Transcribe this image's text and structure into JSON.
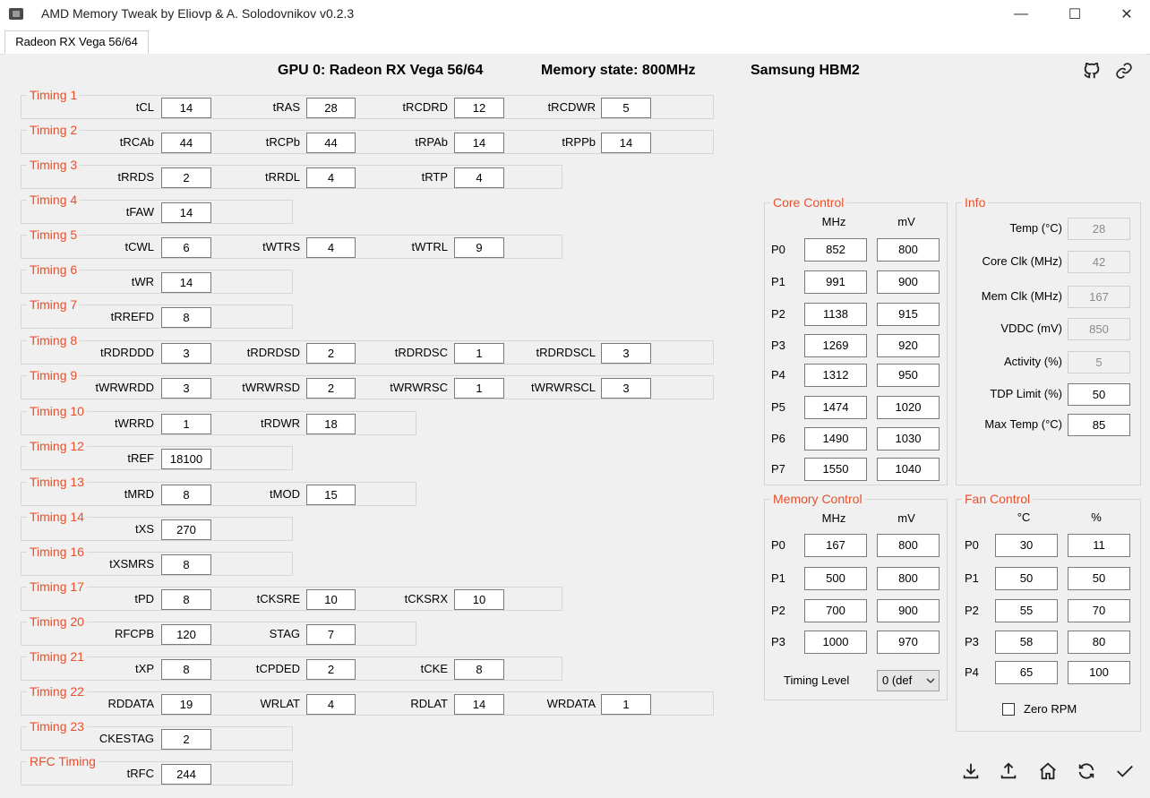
{
  "window": {
    "title": "AMD Memory Tweak by Eliovp & A. Solodovnikov v0.2.3"
  },
  "tabs": [
    "Radeon RX Vega 56/64"
  ],
  "header": {
    "gpu": "GPU 0: Radeon RX Vega 56/64",
    "memory_state": "Memory state: 800MHz",
    "memory_type": "Samsung HBM2"
  },
  "icons": {
    "github": "github-icon",
    "link": "link-icon",
    "download": "download-icon",
    "upload": "upload-icon",
    "home": "home-icon",
    "refresh": "refresh-icon",
    "apply": "check-icon"
  },
  "timings": [
    {
      "title": "Timing 1",
      "fields": [
        {
          "label": "tCL",
          "value": "14"
        },
        {
          "label": "tRAS",
          "value": "28"
        },
        {
          "label": "tRCDRD",
          "value": "12"
        },
        {
          "label": "tRCDWR",
          "value": "5"
        }
      ]
    },
    {
      "title": "Timing 2",
      "fields": [
        {
          "label": "tRCAb",
          "value": "44"
        },
        {
          "label": "tRCPb",
          "value": "44"
        },
        {
          "label": "tRPAb",
          "value": "14"
        },
        {
          "label": "tRPPb",
          "value": "14"
        }
      ]
    },
    {
      "title": "Timing 3",
      "fields": [
        {
          "label": "tRRDS",
          "value": "2"
        },
        {
          "label": "tRRDL",
          "value": "4"
        },
        {
          "label": "tRTP",
          "value": "4"
        }
      ]
    },
    {
      "title": "Timing 4",
      "fields": [
        {
          "label": "tFAW",
          "value": "14"
        }
      ]
    },
    {
      "title": "Timing 5",
      "fields": [
        {
          "label": "tCWL",
          "value": "6"
        },
        {
          "label": "tWTRS",
          "value": "4"
        },
        {
          "label": "tWTRL",
          "value": "9"
        }
      ]
    },
    {
      "title": "Timing 6",
      "fields": [
        {
          "label": "tWR",
          "value": "14"
        }
      ]
    },
    {
      "title": "Timing 7",
      "fields": [
        {
          "label": "tRREFD",
          "value": "8"
        }
      ]
    },
    {
      "title": "Timing 8",
      "fields": [
        {
          "label": "tRDRDDD",
          "value": "3"
        },
        {
          "label": "tRDRDSD",
          "value": "2"
        },
        {
          "label": "tRDRDSC",
          "value": "1"
        },
        {
          "label": "tRDRDSCL",
          "value": "3"
        }
      ]
    },
    {
      "title": "Timing 9",
      "fields": [
        {
          "label": "tWRWRDD",
          "value": "3"
        },
        {
          "label": "tWRWRSD",
          "value": "2"
        },
        {
          "label": "tWRWRSC",
          "value": "1"
        },
        {
          "label": "tWRWRSCL",
          "value": "3"
        }
      ]
    },
    {
      "title": "Timing 10",
      "fields": [
        {
          "label": "tWRRD",
          "value": "1"
        },
        {
          "label": "tRDWR",
          "value": "18"
        }
      ]
    },
    {
      "title": "Timing 12",
      "fields": [
        {
          "label": "tREF",
          "value": "18100"
        }
      ]
    },
    {
      "title": "Timing 13",
      "fields": [
        {
          "label": "tMRD",
          "value": "8"
        },
        {
          "label": "tMOD",
          "value": "15"
        }
      ]
    },
    {
      "title": "Timing 14",
      "fields": [
        {
          "label": "tXS",
          "value": "270"
        }
      ]
    },
    {
      "title": "Timing 16",
      "fields": [
        {
          "label": "tXSMRS",
          "value": "8"
        }
      ]
    },
    {
      "title": "Timing 17",
      "fields": [
        {
          "label": "tPD",
          "value": "8"
        },
        {
          "label": "tCKSRE",
          "value": "10"
        },
        {
          "label": "tCKSRX",
          "value": "10"
        }
      ]
    },
    {
      "title": "Timing 20",
      "fields": [
        {
          "label": "RFCPB",
          "value": "120"
        },
        {
          "label": "STAG",
          "value": "7"
        }
      ]
    },
    {
      "title": "Timing 21",
      "fields": [
        {
          "label": "tXP",
          "value": "8"
        },
        {
          "label": "tCPDED",
          "value": "2"
        },
        {
          "label": "tCKE",
          "value": "8"
        }
      ]
    },
    {
      "title": "Timing 22",
      "fields": [
        {
          "label": "RDDATA",
          "value": "19"
        },
        {
          "label": "WRLAT",
          "value": "4"
        },
        {
          "label": "RDLAT",
          "value": "14"
        },
        {
          "label": "WRDATA",
          "value": "1"
        }
      ]
    },
    {
      "title": "Timing 23",
      "fields": [
        {
          "label": "CKESTAG",
          "value": "2"
        }
      ]
    },
    {
      "title": "RFC Timing",
      "fields": [
        {
          "label": "tRFC",
          "value": "244"
        }
      ]
    }
  ],
  "core_control": {
    "title": "Core Control",
    "col1": "MHz",
    "col2": "mV",
    "rows": [
      [
        "P0",
        "852",
        "800"
      ],
      [
        "P1",
        "991",
        "900"
      ],
      [
        "P2",
        "1138",
        "915"
      ],
      [
        "P3",
        "1269",
        "920"
      ],
      [
        "P4",
        "1312",
        "950"
      ],
      [
        "P5",
        "1474",
        "1020"
      ],
      [
        "P6",
        "1490",
        "1030"
      ],
      [
        "P7",
        "1550",
        "1040"
      ]
    ]
  },
  "info": {
    "title": "Info",
    "rows": [
      {
        "label": "Temp (°C)",
        "value": "28"
      },
      {
        "label": "Core Clk (MHz)",
        "value": "42"
      },
      {
        "label": "Mem Clk (MHz)",
        "value": "167"
      },
      {
        "label": "VDDC (mV)",
        "value": "850"
      },
      {
        "label": "Activity (%)",
        "value": "5"
      },
      {
        "label": "TDP Limit (%)",
        "value": "50"
      },
      {
        "label": "Max Temp (°C)",
        "value": "85"
      }
    ]
  },
  "memory_control": {
    "title": "Memory Control",
    "col1": "MHz",
    "col2": "mV",
    "rows": [
      [
        "P0",
        "167",
        "800"
      ],
      [
        "P1",
        "500",
        "800"
      ],
      [
        "P2",
        "700",
        "900"
      ],
      [
        "P3",
        "1000",
        "970"
      ]
    ],
    "timing_level_label": "Timing Level",
    "timing_level_value": "0 (def"
  },
  "fan_control": {
    "title": "Fan Control",
    "col1": "°C",
    "col2": "%",
    "rows": [
      [
        "P0",
        "30",
        "11"
      ],
      [
        "P1",
        "50",
        "50"
      ],
      [
        "P2",
        "55",
        "70"
      ],
      [
        "P3",
        "58",
        "80"
      ],
      [
        "P4",
        "65",
        "100"
      ]
    ],
    "zero_rpm_label": "Zero RPM"
  }
}
